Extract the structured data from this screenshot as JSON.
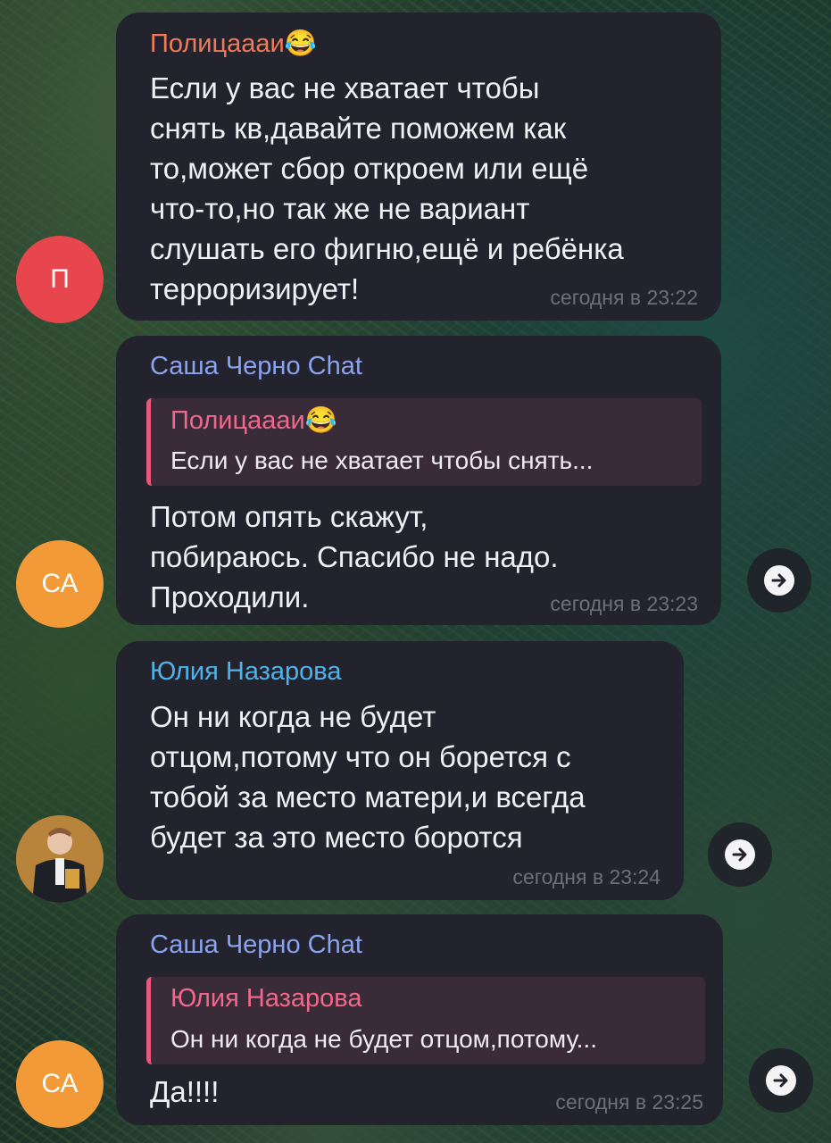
{
  "messages": [
    {
      "sender": "Полицаааи😂",
      "sender_color": "#f07a5a",
      "lines": [
        "Если у вас не хватает  чтобы",
        "снять кв,давайте поможем как",
        "то,может сбор откроем или ещё",
        "что-то,но так же не вариант",
        "слушать его фигню,ещё и ребёнка",
        "терроризирует!"
      ],
      "time": "сегодня в 23:22",
      "avatar_initials": "П",
      "avatar_color": "#e8464e"
    },
    {
      "sender": "Саша Черно Chat",
      "sender_color": "#8aa3f0",
      "reply": {
        "name": "Полицаааи😂",
        "text": "Если у вас не хватает  чтобы снять..."
      },
      "lines": [
        "Потом опять скажут,",
        "побираюсь. Спасибо не надо.",
        "Проходили."
      ],
      "time": "сегодня в 23:23",
      "avatar_initials": "СА",
      "avatar_color": "#f29a38"
    },
    {
      "sender": "Юлия Назарова",
      "sender_color": "#4fb3ea",
      "lines": [
        "Он ни когда не будет",
        "отцом,потому что он борется с",
        "тобой за место матери,и всегда",
        "будет за это место боротся"
      ],
      "time": "сегодня в 23:24",
      "avatar_icon": "person-photo"
    },
    {
      "sender": "Саша Черно Chat",
      "sender_color": "#8aa3f0",
      "reply": {
        "name": "Юлия Назарова",
        "text": "Он ни когда не будет отцом,потому..."
      },
      "lines": [
        "Да!!!!"
      ],
      "time": "сегодня в 23:25",
      "avatar_initials": "СА",
      "avatar_color": "#f29a38"
    }
  ],
  "icons": {
    "forward": "forward-arrow-icon"
  }
}
